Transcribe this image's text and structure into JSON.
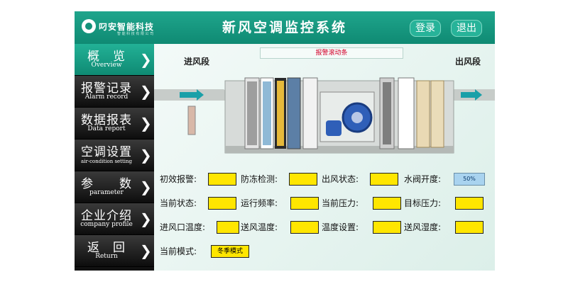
{
  "header": {
    "logo_text": "叼安智能科技",
    "logo_sub": "智 能 科 技 有 限 公 司",
    "title": "新风空调监控系统",
    "login_label": "登录",
    "logout_label": "退出"
  },
  "sidebar": {
    "items": [
      {
        "cn": "概　览",
        "en": "Overview",
        "active": true
      },
      {
        "cn": "报警记录",
        "en": "Alarm record",
        "active": false
      },
      {
        "cn": "数据报表",
        "en": "Data report",
        "active": false
      },
      {
        "cn": "空调设置",
        "en": "air-condition setting",
        "active": false
      },
      {
        "cn": "参　　数",
        "en": "parameter",
        "active": false
      },
      {
        "cn": "企业介绍",
        "en": "company profile",
        "active": false
      },
      {
        "cn": "返　回",
        "en": "Return",
        "active": false
      }
    ],
    "arrow": "❯"
  },
  "diagram": {
    "alarm_text": "报警滚动条",
    "inlet_label": "进风段",
    "outlet_label": "出风段"
  },
  "params": {
    "primary_filter_alarm": "初效报警:",
    "antifreeze_detect": "防冻检测:",
    "outlet_status": "出风状态:",
    "valve_opening": "水阀开度:",
    "valve_value": "50%",
    "current_status": "当前状态:",
    "run_frequency": "运行频率:",
    "current_pressure": "当前压力:",
    "target_pressure": "目标压力:",
    "inlet_temp": "进风口温度:",
    "supply_temp": "送风温度:",
    "temp_setting": "温度设置:",
    "supply_humidity": "送风湿度:",
    "current_mode": "当前模式:",
    "mode_value": "冬季模式"
  },
  "colors": {
    "header": "#13917a",
    "active_nav": "#1a9e84",
    "value_box": "#ffe600",
    "alarm_text": "#d4002a"
  }
}
